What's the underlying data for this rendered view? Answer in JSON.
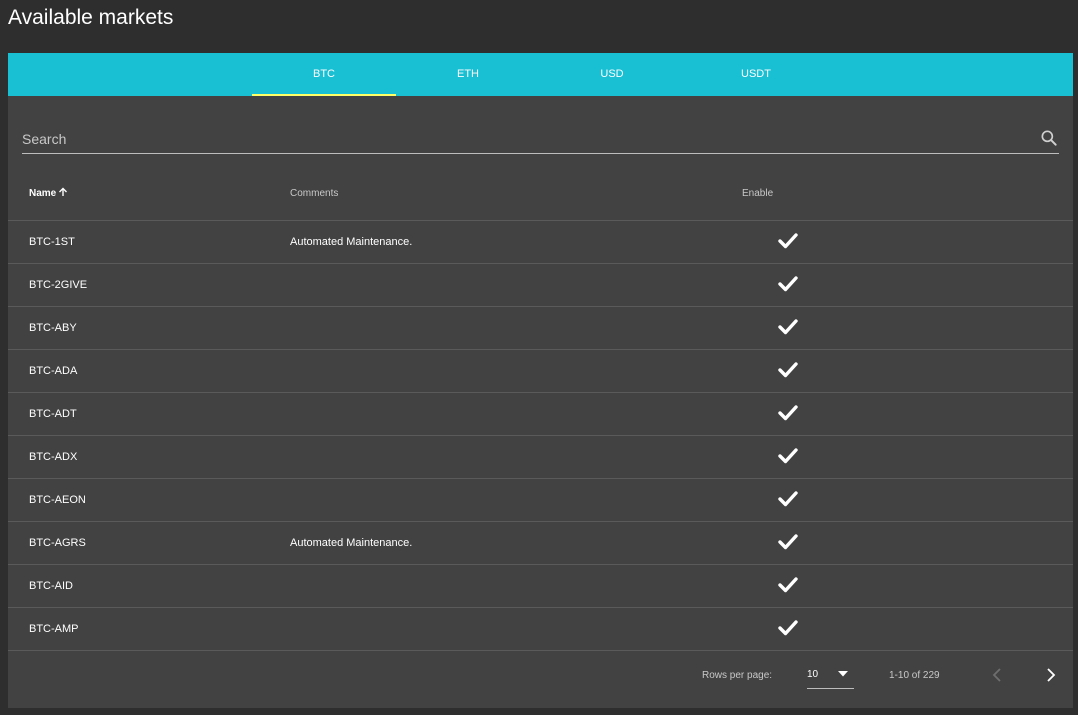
{
  "page": {
    "title": "Available markets"
  },
  "tabs": [
    {
      "label": "BTC",
      "active": true
    },
    {
      "label": "ETH",
      "active": false
    },
    {
      "label": "USD",
      "active": false
    },
    {
      "label": "USDT",
      "active": false
    }
  ],
  "search": {
    "placeholder": "Search",
    "value": ""
  },
  "table": {
    "columns": {
      "name": "Name",
      "comments": "Comments",
      "enable": "Enable"
    },
    "sort": {
      "column": "name",
      "direction": "ascending"
    },
    "rows": [
      {
        "name": "BTC-1ST",
        "comment": "Automated Maintenance.",
        "enabled": true
      },
      {
        "name": "BTC-2GIVE",
        "comment": "",
        "enabled": true
      },
      {
        "name": "BTC-ABY",
        "comment": "",
        "enabled": true
      },
      {
        "name": "BTC-ADA",
        "comment": "",
        "enabled": true
      },
      {
        "name": "BTC-ADT",
        "comment": "",
        "enabled": true
      },
      {
        "name": "BTC-ADX",
        "comment": "",
        "enabled": true
      },
      {
        "name": "BTC-AEON",
        "comment": "",
        "enabled": true
      },
      {
        "name": "BTC-AGRS",
        "comment": "Automated Maintenance.",
        "enabled": true
      },
      {
        "name": "BTC-AID",
        "comment": "",
        "enabled": true
      },
      {
        "name": "BTC-AMP",
        "comment": "",
        "enabled": true
      }
    ]
  },
  "pagination": {
    "rows_per_page_label": "Rows per page:",
    "rows_per_page": "10",
    "range": "1-10 of 229",
    "prev_enabled": false,
    "next_enabled": true
  },
  "colors": {
    "background": "#2e2e2e",
    "card": "#424242",
    "accent": "#19bfd3",
    "tab_indicator": "#ffff66"
  },
  "icons": {
    "search": "search-icon",
    "sort": "arrow-up-icon",
    "enabled": "check-icon",
    "dropdown": "caret-down-icon",
    "prev": "chevron-left-icon",
    "next": "chevron-right-icon"
  }
}
